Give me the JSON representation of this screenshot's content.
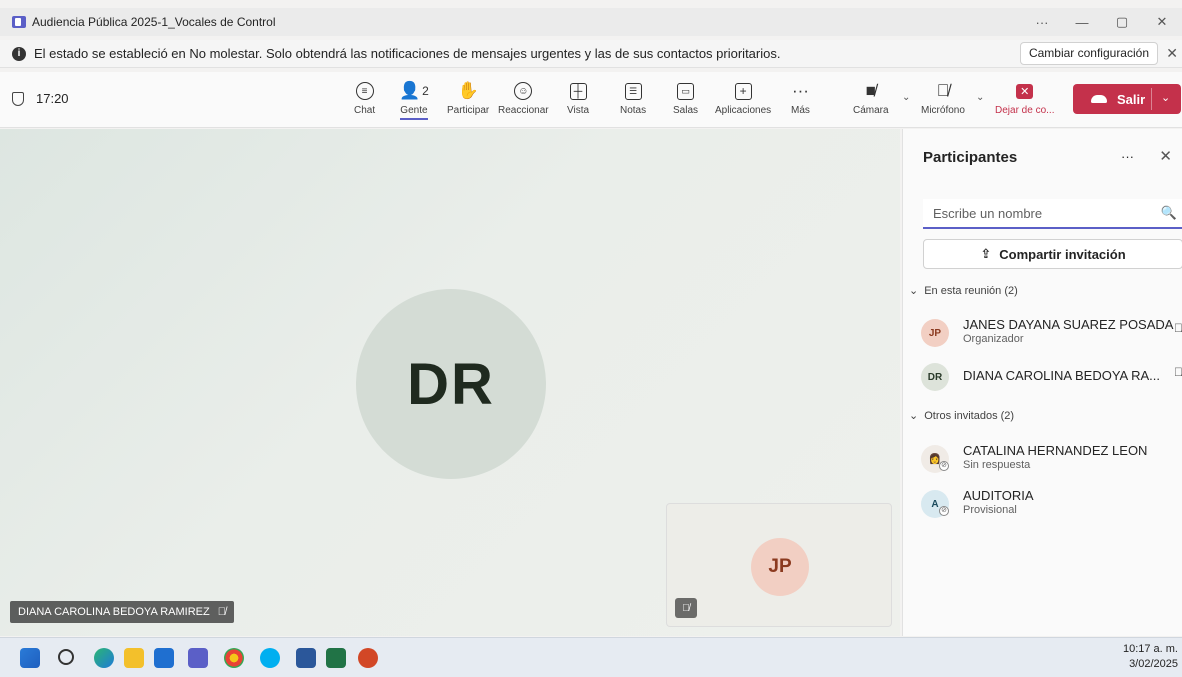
{
  "window": {
    "title": "Audiencia Pública 2025-1_Vocales de Control",
    "more": "···",
    "minimize": "—",
    "restore": "▢",
    "close": "✕"
  },
  "banner": {
    "message": "El estado se estableció en No molestar. Solo obtendrá las notificaciones de mensajes urgentes y las de sus contactos prioritarios.",
    "action_label": "Cambiar configuración",
    "close": "✕"
  },
  "toolbar": {
    "elapsed_time": "17:20",
    "people_count": "2",
    "items": [
      {
        "label": "Chat",
        "icon": "chat-icon"
      },
      {
        "label": "Gente",
        "icon": "people-icon"
      },
      {
        "label": "Participar",
        "icon": "raise-hand-icon"
      },
      {
        "label": "Reaccionar",
        "icon": "smile-icon"
      },
      {
        "label": "Vista",
        "icon": "grid-view-icon"
      },
      {
        "label": "Notas",
        "icon": "notes-icon"
      },
      {
        "label": "Salas",
        "icon": "rooms-icon"
      },
      {
        "label": "Aplicaciones",
        "icon": "apps-plus-icon"
      },
      {
        "label": "Más",
        "icon": "more-icon"
      },
      {
        "label": "Cámara",
        "icon": "camera-off-icon"
      },
      {
        "label": "Micrófono",
        "icon": "mic-off-icon"
      },
      {
        "label": "Dejar de co...",
        "icon": "stop-share-icon"
      }
    ],
    "leave_label": "Salir",
    "active_item": "Gente",
    "leave_color": "#c4314b",
    "accent_color": "#5b5fc7"
  },
  "stage": {
    "main_initials": "DR",
    "main_name": "DIANA CAROLINA BEDOYA RAMIREZ",
    "self_initials": "JP"
  },
  "panel": {
    "title": "Participantes",
    "more": "···",
    "close": "✕",
    "search_placeholder": "Escribe un nombre",
    "share_label": "Compartir invitación",
    "section_in_meeting": "En esta reunión (2)",
    "section_others": "Otros invitados (2)",
    "in_meeting": [
      {
        "initials": "JP",
        "name": "JANES DAYANA SUAREZ POSADA",
        "role": "Organizador"
      },
      {
        "initials": "DR",
        "name": "DIANA CAROLINA BEDOYA RA...",
        "role": ""
      }
    ],
    "others": [
      {
        "initials": "",
        "name": "CATALINA HERNANDEZ LEON",
        "status": "Sin respuesta"
      },
      {
        "initials": "A",
        "name": "AUDITORIA",
        "status": "Provisional"
      }
    ]
  },
  "taskbar": {
    "time": "10:17 a. m.",
    "date": "3/02/2025"
  }
}
